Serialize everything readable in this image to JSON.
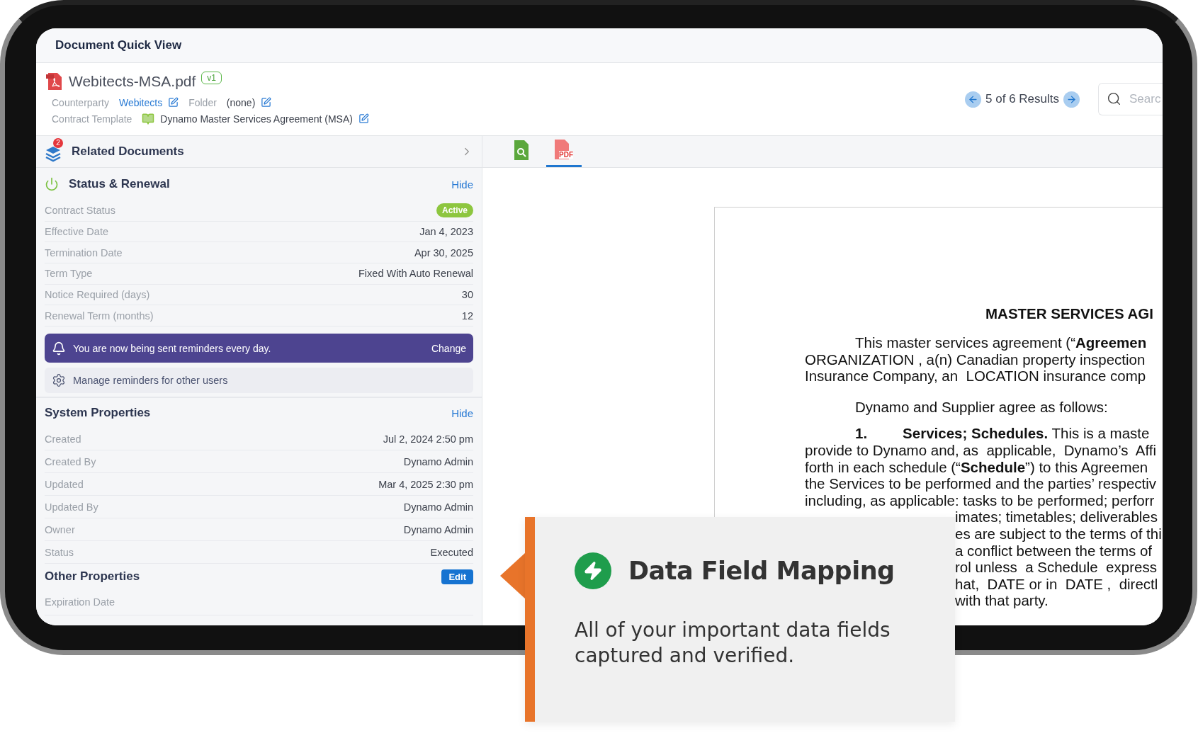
{
  "window": {
    "title": "Document Quick View"
  },
  "document": {
    "file_name": "Webitects-MSA.pdf",
    "version": "v1",
    "meta": [
      {
        "kind": "link",
        "label": "Counterparty",
        "value": "Webitects"
      },
      {
        "kind": "plain",
        "label": "Folder",
        "value": "(none)"
      },
      {
        "kind": "template",
        "label": "Contract Template",
        "value": "Dynamo Master Services Agreement (MSA)"
      }
    ]
  },
  "pager": {
    "text": "5 of 6 Results"
  },
  "search": {
    "placeholder": "Searc"
  },
  "related": {
    "title": "Related Documents",
    "count": "2"
  },
  "status_section": {
    "title": "Status & Renewal",
    "action": {
      "label": "Hide",
      "kind": "link"
    },
    "rows": [
      {
        "label": "Contract Status",
        "value": "Active",
        "kind": "badge"
      },
      {
        "label": "Effective Date",
        "value": "Jan 4, 2023",
        "kind": "text"
      },
      {
        "label": "Termination Date",
        "value": "Apr 30, 2025",
        "kind": "text"
      },
      {
        "label": "Term Type",
        "value": "Fixed With Auto Renewal",
        "kind": "text"
      },
      {
        "label": "Notice Required (days)",
        "value": "30",
        "kind": "text"
      },
      {
        "label": "Renewal Term (months)",
        "value": "12",
        "kind": "text"
      }
    ]
  },
  "reminder": {
    "text": "You are now being sent reminders every day.",
    "action": "Change"
  },
  "manage_reminders": {
    "text": "Manage reminders for other users"
  },
  "system_section": {
    "title": "System Properties",
    "action": {
      "label": "Hide",
      "kind": "link"
    },
    "rows": [
      {
        "label": "Created",
        "value": "Jul 2, 2024 2:50 pm",
        "kind": "text"
      },
      {
        "label": "Created By",
        "value": "Dynamo Admin",
        "kind": "text"
      },
      {
        "label": "Updated",
        "value": "Mar 4, 2025 2:30 pm",
        "kind": "text"
      },
      {
        "label": "Updated By",
        "value": "Dynamo Admin",
        "kind": "text"
      },
      {
        "label": "Owner",
        "value": "Dynamo Admin",
        "kind": "text"
      },
      {
        "label": "Status",
        "value": "Executed",
        "kind": "text"
      }
    ]
  },
  "other_section": {
    "title": "Other Properties",
    "action": {
      "label": "Edit",
      "kind": "button"
    },
    "rows": [
      {
        "label": "Expiration Date"
      }
    ]
  },
  "viewer_tabs": [
    {
      "kind": "search",
      "selected": false
    },
    {
      "kind": "pdf",
      "label": "PDF",
      "selected": true
    }
  ],
  "page": {
    "title": "MASTER SERVICES AGI",
    "lines": [
      {
        "kind": "indent",
        "text": "This master services agreement (“**Agreemen**"
      },
      {
        "kind": "plain",
        "text": "ORGANIZATION , a(n) Canadian property inspection"
      },
      {
        "kind": "plain",
        "text": "Insurance Company, an  LOCATION insurance comp"
      },
      {
        "kind": "gap",
        "text": "Dynamo and Supplier agree as follows:"
      },
      {
        "kind": "item",
        "number": "1.",
        "text": "**Services; Schedules.** This is a maste"
      },
      {
        "kind": "plain",
        "text": "provide to Dynamo and, as  applicable,  Dynamo’s  Affi"
      },
      {
        "kind": "plain",
        "text": "forth in each schedule (“**Schedule**”) to this Agreemen"
      },
      {
        "kind": "plain",
        "text": "the Services to be performed and the parties’ respectiv"
      },
      {
        "kind": "plain",
        "text": "including, as applicable: tasks to be performed; perforr"
      },
      {
        "kind": "tail",
        "text": "imates; timetables; deliverables"
      },
      {
        "kind": "tail",
        "text": "es are subject to the terms of thi"
      },
      {
        "kind": "tail",
        "text": "a conflict between the terms of"
      },
      {
        "kind": "tail",
        "text": "rol unless  a Schedule  express"
      },
      {
        "kind": "tail",
        "text": "hat,  DATE or in  DATE ,  directl"
      },
      {
        "kind": "tail",
        "text": "with that party."
      }
    ]
  },
  "callout": {
    "title": "Data Field Mapping",
    "text": "All of your important data fields captured and verified."
  }
}
